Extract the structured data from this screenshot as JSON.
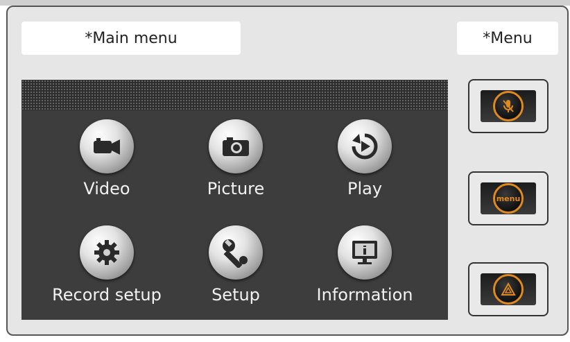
{
  "header": {
    "main_label": "*Main menu",
    "menu_label": "*Menu"
  },
  "tiles": [
    {
      "label": "Video",
      "icon": "video-camera-icon"
    },
    {
      "label": "Picture",
      "icon": "camera-icon"
    },
    {
      "label": "Play",
      "icon": "play-icon"
    },
    {
      "label": "Record setup",
      "icon": "gear-icon"
    },
    {
      "label": "Setup",
      "icon": "wrench-icon"
    },
    {
      "label": "Information",
      "icon": "information-icon"
    }
  ],
  "side_buttons": [
    {
      "icon": "mic-mute-icon"
    },
    {
      "icon": "menu-icon",
      "text": "menu"
    },
    {
      "icon": "hazard-icon"
    }
  ],
  "colors": {
    "accent": "#e08a1e",
    "panel": "#3d3d3d",
    "frame": "#e6e6e6"
  }
}
